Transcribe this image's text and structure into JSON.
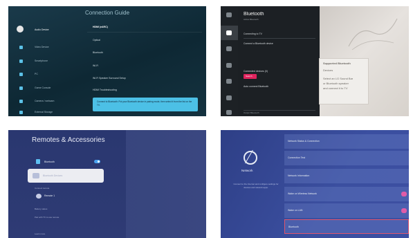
{
  "panel1": {
    "title": "Connection Guide",
    "sidebar": [
      "Audio Device",
      "Video Device",
      "Smartphone",
      "PC",
      "Game Console",
      "Camera / webcam",
      "External Storage"
    ],
    "options": [
      "HDMI (eARC)",
      "Optical",
      "Bluetooth",
      "Wi-Fi",
      "Wi-Fi Speaker Surround Setup",
      "HDMI Troubleshooting"
    ],
    "info": "Connect to Bluetooth: Put your Bluetooth device in pairing mode, then select it from the list on the TV."
  },
  "panel2": {
    "title": "Bluetooth",
    "subtitle": "Active Bluetooth",
    "items": [
      "Connecting to TV",
      "Connect a Bluetooth device",
      "Connected devices (0)",
      "Search"
    ],
    "checkbox": "Auto connect Bluetooth",
    "footer": "Output Bluetooth",
    "card": [
      "Supported Bluetooth",
      "Devices",
      "Select an LG Sound Bar",
      "or Bluetooth speaker",
      "and connect it to TV"
    ]
  },
  "panel3": {
    "title": "Remotes & Accessories",
    "bluetooth_label": "Bluetooth",
    "selected": "Bluetooth Devices",
    "remote_label": "Remote 1",
    "notes": [
      "Connect remote",
      "Battery status",
      "Pair with TV to use remote",
      "Learn more"
    ]
  },
  "panel4": {
    "label": "Network",
    "desc": "Connect to the Internet and configure settings for devices and network apps.",
    "rows": [
      "Network Status & Connection",
      "Connection Test",
      "Network Information",
      "Wake on Wireless Network",
      "Wake on LAN",
      "Bluetooth"
    ]
  }
}
